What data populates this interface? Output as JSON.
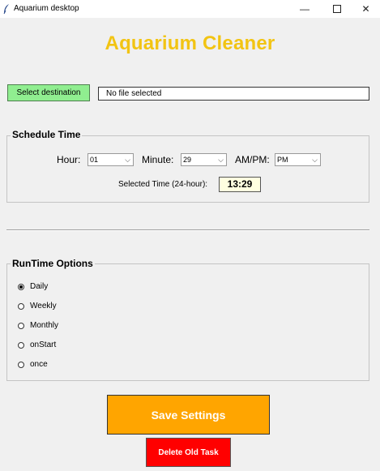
{
  "window": {
    "title": "Aquarium desktop",
    "minimize": "—",
    "close": "✕"
  },
  "header": {
    "title": "Aquarium Cleaner"
  },
  "destination": {
    "button_label": "Select destination",
    "path_value": "No file selected"
  },
  "schedule": {
    "section_label": "Schedule Time",
    "hour_label": "Hour:",
    "hour_value": "01",
    "minute_label": "Minute:",
    "minute_value": "29",
    "ampm_label": "AM/PM:",
    "ampm_value": "PM",
    "selected_label": "Selected Time (24-hour):",
    "selected_value": "13:29"
  },
  "runtime": {
    "section_label": "RunTime Options",
    "options": [
      {
        "label": "Daily",
        "checked": true
      },
      {
        "label": "Weekly",
        "checked": false
      },
      {
        "label": "Monthly",
        "checked": false
      },
      {
        "label": "onStart",
        "checked": false
      },
      {
        "label": "once",
        "checked": false
      }
    ]
  },
  "actions": {
    "save_label": "Save Settings",
    "delete_label": "Delete Old Task"
  },
  "colors": {
    "title": "#f2c413",
    "select_button": "#90ee90",
    "save_button": "#ffa500",
    "delete_button": "#ff0000",
    "time_display_bg": "#ffffe0"
  }
}
